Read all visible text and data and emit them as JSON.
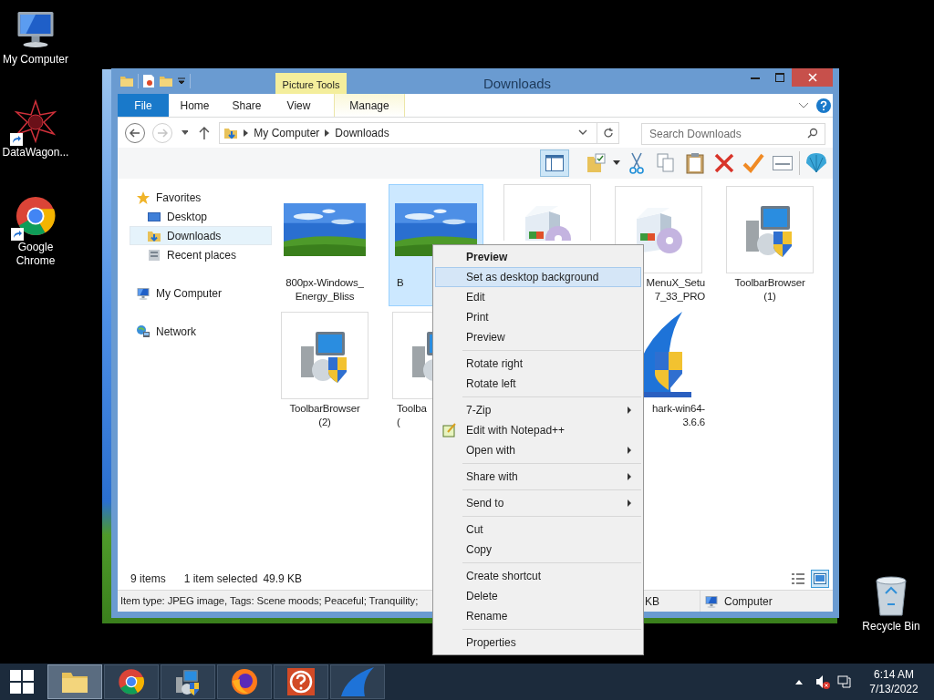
{
  "desktop_icons": [
    {
      "label": "My Computer",
      "kind": "computer",
      "shortcut": false
    },
    {
      "label": "DataWagon...",
      "kind": "mandala",
      "shortcut": true
    },
    {
      "label": "Google Chrome",
      "kind": "chrome",
      "shortcut": true
    },
    {
      "label": "Recycle Bin",
      "kind": "bin",
      "shortcut": false
    }
  ],
  "window": {
    "title": "Downloads",
    "context_tab": "Picture Tools"
  },
  "ribbon_tabs": [
    {
      "label": "File",
      "kind": "file",
      "selected": false
    },
    {
      "label": "Home",
      "kind": "plain",
      "selected": false
    },
    {
      "label": "Share",
      "kind": "plain",
      "selected": false
    },
    {
      "label": "View",
      "kind": "plain",
      "selected": false
    },
    {
      "label": "Manage",
      "kind": "context",
      "selected": false
    }
  ],
  "address": {
    "path": [
      "My Computer",
      "Downloads"
    ],
    "search_placeholder": "Search Downloads"
  },
  "nav": [
    {
      "label": "Favorites",
      "selected": false,
      "children": [
        {
          "label": "Desktop",
          "selected": false
        },
        {
          "label": "Downloads",
          "selected": true
        },
        {
          "label": "Recent places",
          "selected": false
        }
      ]
    },
    {
      "label": "My Computer",
      "selected": false
    },
    {
      "label": "Network",
      "selected": false
    }
  ],
  "files": [
    {
      "label": [
        "800px-Windows_",
        "Energy_Bliss"
      ],
      "selected": false
    },
    {
      "label": [
        "B"
      ],
      "selected": true
    },
    {
      "kind": "setup",
      "selected": false
    },
    {
      "kind": "setup",
      "label": [
        "MenuX_Setu",
        "7_33_PRO"
      ],
      "selected": false
    },
    {
      "kind": "installer",
      "label": [
        "ToolbarBrowser",
        "(1)"
      ],
      "selected": false
    },
    {
      "kind": "installer",
      "label": [
        "ToolbarBrowser",
        "(2)"
      ],
      "selected": false
    },
    {
      "kind": "installer",
      "label": [
        "Toolba",
        "("
      ],
      "selected": false
    },
    {
      "kind": "hidden"
    },
    {
      "kind": "shark",
      "label": [
        "hark-win64-",
        "3.6.6"
      ],
      "selected": false
    }
  ],
  "status": {
    "count": "9 items",
    "selection": "1 item selected",
    "size": "49.9 KB",
    "views": [
      {
        "kind": "details",
        "selected": false
      },
      {
        "kind": "large",
        "selected": true
      }
    ]
  },
  "details": {
    "text": "Item type: JPEG image, Tags: Scene moods; Peaceful; Tranquility;",
    "size": "KB",
    "location": "Computer"
  },
  "context_menu": [
    [
      {
        "label": "Preview",
        "bold": true,
        "selected": false,
        "submenu": false,
        "icon": false
      },
      {
        "label": "Set as desktop background",
        "bold": false,
        "selected": true,
        "submenu": false,
        "icon": false
      },
      {
        "label": "Edit",
        "bold": false,
        "selected": false,
        "submenu": false,
        "icon": false
      },
      {
        "label": "Print",
        "bold": false,
        "selected": false,
        "submenu": false,
        "icon": false
      },
      {
        "label": "Preview",
        "bold": false,
        "selected": false,
        "submenu": false,
        "icon": false
      }
    ],
    [
      {
        "label": "Rotate right",
        "bold": false,
        "selected": false,
        "submenu": false,
        "icon": false
      },
      {
        "label": "Rotate left",
        "bold": false,
        "selected": false,
        "submenu": false,
        "icon": false
      }
    ],
    [
      {
        "label": "7-Zip",
        "bold": false,
        "selected": false,
        "submenu": true,
        "icon": false
      },
      {
        "label": "Edit with Notepad++",
        "bold": false,
        "selected": false,
        "submenu": false,
        "icon": true
      },
      {
        "label": "Open with",
        "bold": false,
        "selected": false,
        "submenu": true,
        "icon": false
      }
    ],
    [
      {
        "label": "Share with",
        "bold": false,
        "selected": false,
        "submenu": true,
        "icon": false
      }
    ],
    [
      {
        "label": "Send to",
        "bold": false,
        "selected": false,
        "submenu": true,
        "icon": false
      }
    ],
    [
      {
        "label": "Cut",
        "bold": false,
        "selected": false,
        "submenu": false,
        "icon": false
      },
      {
        "label": "Copy",
        "bold": false,
        "selected": false,
        "submenu": false,
        "icon": false
      }
    ],
    [
      {
        "label": "Create shortcut",
        "bold": false,
        "selected": false,
        "submenu": false,
        "icon": false
      },
      {
        "label": "Delete",
        "bold": false,
        "selected": false,
        "submenu": false,
        "icon": false
      },
      {
        "label": "Rename",
        "bold": false,
        "selected": false,
        "submenu": false,
        "icon": false
      }
    ],
    [
      {
        "label": "Properties",
        "bold": false,
        "selected": false,
        "submenu": false,
        "icon": false
      }
    ]
  ],
  "taskbar": {
    "apps": [
      {
        "kind": "explorer",
        "selected": true
      },
      {
        "kind": "chrome",
        "selected": false
      },
      {
        "kind": "installer",
        "selected": false
      },
      {
        "kind": "firefox",
        "selected": false
      },
      {
        "kind": "help",
        "selected": false
      },
      {
        "kind": "shark",
        "selected": false
      }
    ],
    "time": "6:14 AM",
    "date": "7/13/2022"
  }
}
